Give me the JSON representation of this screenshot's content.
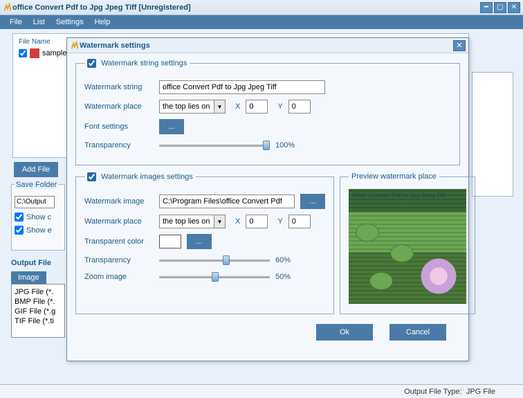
{
  "window": {
    "title": "office Convert Pdf to Jpg Jpeg Tiff [Unregistered]"
  },
  "menu": {
    "file": "File",
    "list": "List",
    "settings": "Settings",
    "help": "Help"
  },
  "filelist": {
    "header_name": "File Name",
    "items": [
      {
        "name": "sample"
      }
    ]
  },
  "buttons_bg": {
    "add_file": "Add File"
  },
  "save_folder": {
    "legend": "Save Folder",
    "path": "C:\\Output",
    "show_c": "Show c",
    "show_e": "Show e"
  },
  "output": {
    "label": "Output File",
    "tab": "Image",
    "types": [
      "JPG File  (*.",
      "BMP File (*.",
      "GIF File  (*.g",
      "TIF File  (*.ti"
    ]
  },
  "statusbar": {
    "output_type_label": "Output File Type:",
    "output_type_value": "JPG File"
  },
  "dialog": {
    "title": "Watermark settings",
    "string_section": {
      "legend": "Watermark string settings",
      "label_string": "Watermark string",
      "value_string": "office Convert Pdf to Jpg Jpeg Tiff",
      "label_place": "Watermark place",
      "place_value": "the top lies on",
      "x_label": "X",
      "x_val": "0",
      "y_label": "Y",
      "y_val": "0",
      "label_font": "Font settings",
      "font_btn": "...",
      "label_transparency": "Transparency",
      "transparency_val": "100%"
    },
    "image_section": {
      "legend": "Watermark images settings",
      "label_image": "Watermark image",
      "image_path": "C:\\Program Files\\office Convert Pdf",
      "browse_btn": "...",
      "label_place": "Watermark place",
      "place_value": "the top lies on",
      "x_label": "X",
      "x_val": "0",
      "y_label": "Y",
      "y_val": "0",
      "label_color": "Transparent color",
      "color_btn": "...",
      "label_transparency": "Transparency",
      "transparency_val": "60%",
      "label_zoom": "Zoom image",
      "zoom_val": "50%"
    },
    "preview": {
      "legend": "Preview watermark place",
      "overlay_text": "office Convert Pdf to Jpg Jpeg Tiff"
    },
    "ok": "Ok",
    "cancel": "Cancel"
  }
}
